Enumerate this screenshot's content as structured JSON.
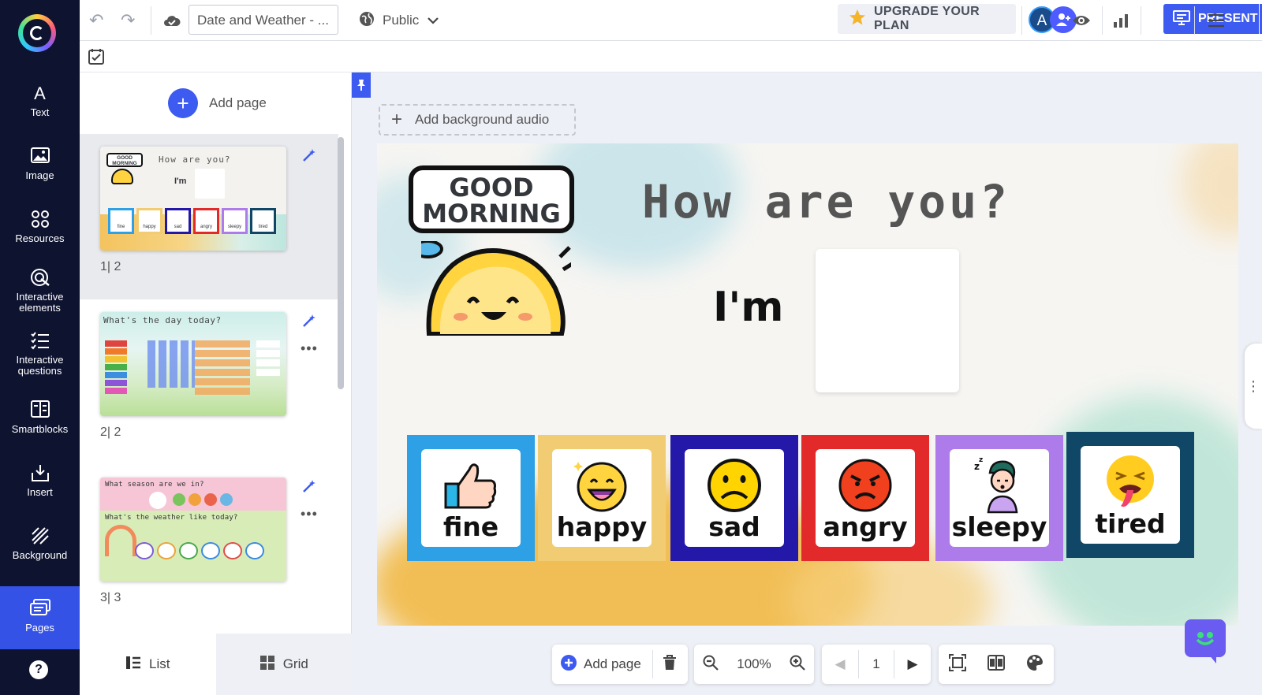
{
  "sidebar": {
    "items": [
      {
        "label": "Text",
        "icon": "text-icon"
      },
      {
        "label": "Image",
        "icon": "image-icon"
      },
      {
        "label": "Resources",
        "icon": "resources-icon"
      },
      {
        "label": "Interactive elements",
        "icon": "interactive-elements-icon"
      },
      {
        "label": "Interactive questions",
        "icon": "interactive-questions-icon"
      },
      {
        "label": "Smartblocks",
        "icon": "smartblocks-icon"
      },
      {
        "label": "Insert",
        "icon": "insert-icon"
      },
      {
        "label": "Background",
        "icon": "background-icon"
      },
      {
        "label": "Pages",
        "icon": "pages-icon",
        "active": true
      }
    ],
    "help": "?"
  },
  "toolbar": {
    "title": "Date and Weather - ...",
    "visibility": "Public",
    "upgrade_label": "UPGRADE YOUR PLAN",
    "avatar_initial": "A",
    "present_label": "PRESENT"
  },
  "panel": {
    "add_page_label": "Add page",
    "pages": [
      {
        "num": "1| 2",
        "thumb_title": "How are you?",
        "thumb_sub": "I'm"
      },
      {
        "num": "2| 2",
        "thumb_title": "What's the day today?"
      },
      {
        "num": "3| 3",
        "thumb_title": "What season are we in?",
        "thumb_sub": "What's the weather like today?"
      }
    ],
    "list_label": "List",
    "grid_label": "Grid"
  },
  "canvas": {
    "audio_label": "Add background audio",
    "slide": {
      "good_morning_line1": "GOOD",
      "good_morning_line2": "MORNING",
      "question": "How are you?",
      "im_label": "I'm",
      "cards": [
        {
          "label": "fine",
          "color": "#2ea0e6"
        },
        {
          "label": "happy",
          "color": "#f2cc73"
        },
        {
          "label": "sad",
          "color": "#2318a8"
        },
        {
          "label": "angry",
          "color": "#e32a2a"
        },
        {
          "label": "sleepy",
          "color": "#ae7bea"
        },
        {
          "label": "tired",
          "color": "#114766"
        }
      ]
    }
  },
  "bottom_bar": {
    "add_page_label": "Add page",
    "zoom": "100%",
    "page_number": "1"
  },
  "colors": {
    "accent": "#3d5af1",
    "sidebar_bg": "#0e1330"
  }
}
